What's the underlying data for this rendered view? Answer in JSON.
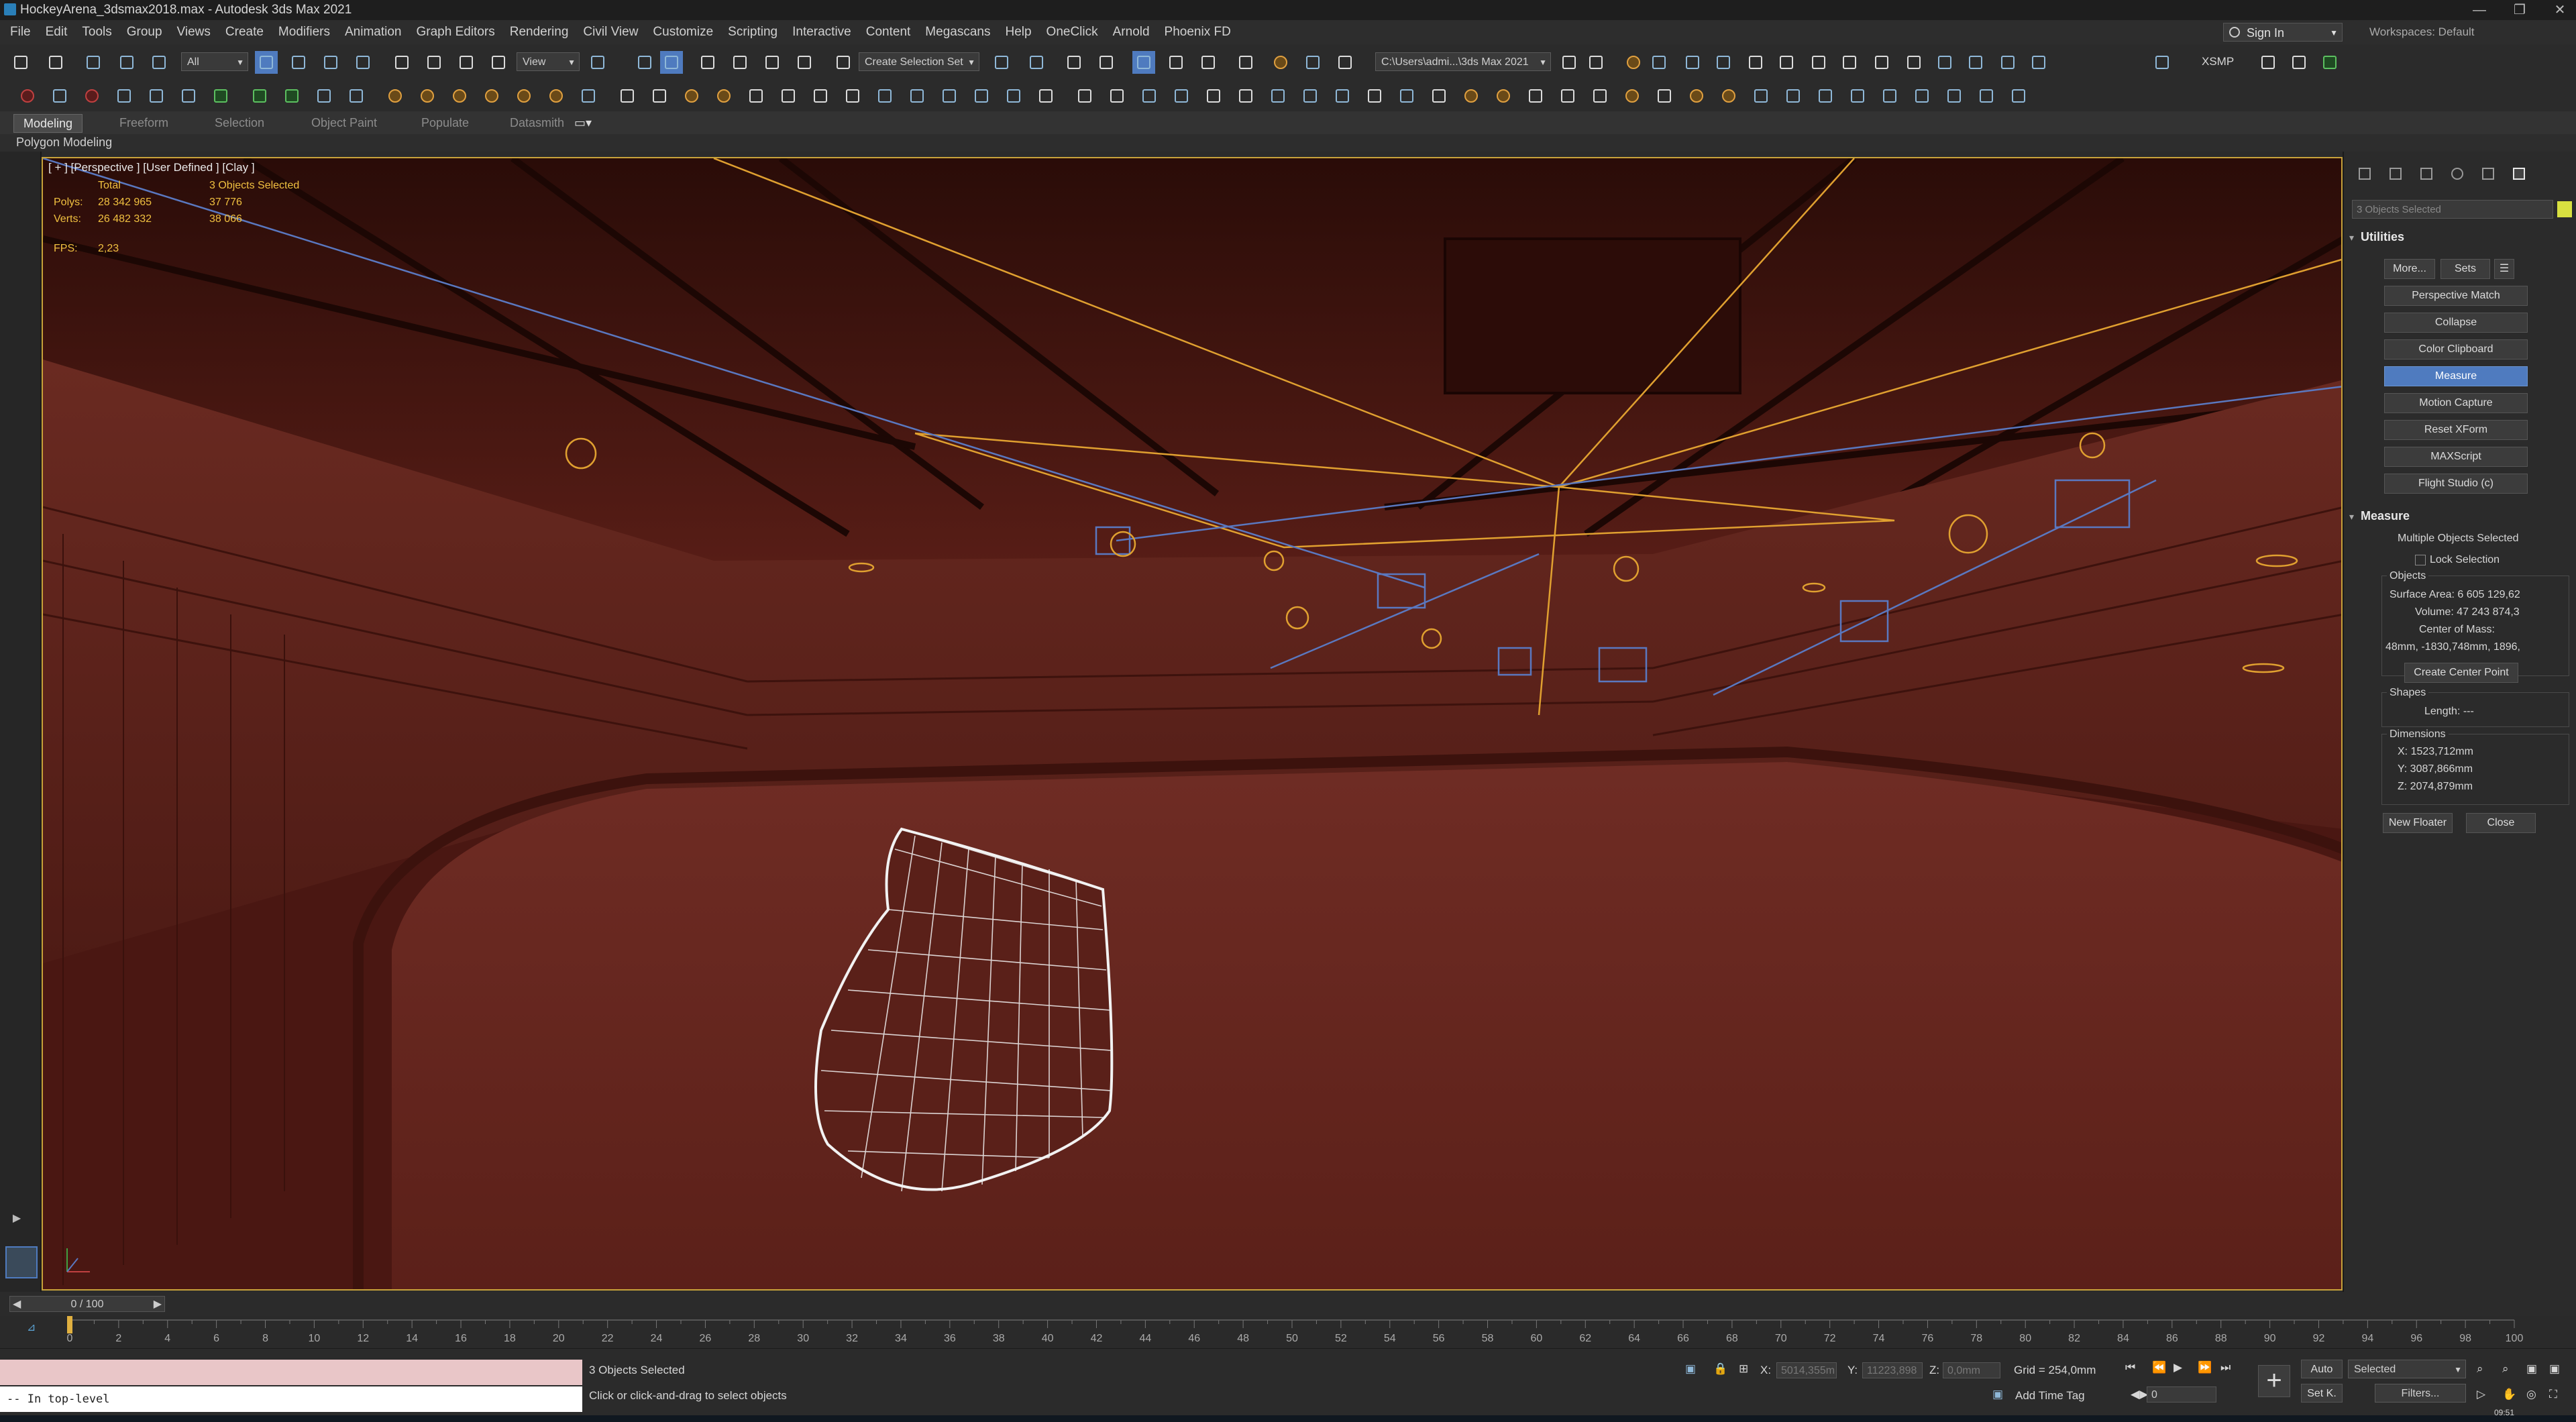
{
  "window": {
    "title": "HockeyArena_3dsmax2018.max - Autodesk 3ds Max 2021",
    "minimize": "—",
    "maximize": "❐",
    "close": "✕"
  },
  "menu": {
    "items": [
      "File",
      "Edit",
      "Tools",
      "Group",
      "Views",
      "Create",
      "Modifiers",
      "Animation",
      "Graph Editors",
      "Rendering",
      "Civil View",
      "Customize",
      "Scripting",
      "Interactive",
      "Content",
      "Megascans",
      "Help",
      "OneClick",
      "Arnold",
      "Phoenix FD"
    ],
    "sign_in": "Sign In",
    "workspaces": "Workspaces: Default"
  },
  "toolbar": {
    "filter": "All",
    "ref_coord": "View",
    "selection_set": "Create Selection Set",
    "project_path": "C:\\Users\\admi...\\3ds Max 2021",
    "xsmp": "XSMP"
  },
  "ribbon": {
    "tabs": [
      "Modeling",
      "Freeform",
      "Selection",
      "Object Paint",
      "Populate",
      "Datasmith"
    ],
    "active_tab": "Modeling",
    "subtitle": "Polygon Modeling"
  },
  "viewport": {
    "label": "[ + ] [Perspective ] [User Defined ] [Clay ]",
    "stats_header": [
      "",
      "Total",
      "3 Objects Selected"
    ],
    "stats_polys": [
      "Polys:",
      "28 342 965",
      "37 776"
    ],
    "stats_verts": [
      "Verts:",
      "26 482 332",
      "38 066"
    ],
    "fps_label": "FPS:",
    "fps_value": "2,23"
  },
  "command_panel": {
    "selection_name": "3 Objects Selected",
    "selection_color": "#d8e040",
    "utilities_title": "Utilities",
    "more": "More...",
    "sets": "Sets",
    "utilities": [
      "Perspective Match",
      "Collapse",
      "Color Clipboard",
      "Measure",
      "Motion Capture",
      "Reset XForm",
      "MAXScript",
      "Flight Studio (c)"
    ],
    "active_utility": "Measure",
    "measure_title": "Measure",
    "multiple": "Multiple Objects Selected",
    "lock_selection": "Lock Selection",
    "objects_label": "Objects",
    "surface_area": "Surface Area: 6 605 129,62",
    "volume": "Volume: 47 243 874,3",
    "center_of_mass": "Center of Mass:",
    "center_value": "48mm, -1830,748mm, 1896,",
    "create_center_point": "Create Center Point",
    "shapes_label": "Shapes",
    "length": "Length: ---",
    "dimensions_label": "Dimensions",
    "dim_x": "X:  1523,712mm",
    "dim_y": "Y:  3087,866mm",
    "dim_z": "Z:  2074,879mm",
    "new_floater": "New Floater",
    "close": "Close"
  },
  "timeline": {
    "slider": "0 / 100",
    "ticks": [
      "0",
      "2",
      "4",
      "6",
      "8",
      "10",
      "12",
      "14",
      "16",
      "18",
      "20",
      "22",
      "24",
      "26",
      "28",
      "30",
      "32",
      "34",
      "36",
      "38",
      "40",
      "42",
      "44",
      "46",
      "48",
      "50",
      "52",
      "54",
      "56",
      "58",
      "60",
      "62",
      "64",
      "66",
      "68",
      "70",
      "72",
      "74",
      "76",
      "78",
      "80",
      "82",
      "84",
      "86",
      "88",
      "90",
      "92",
      "94",
      "96",
      "98",
      "100"
    ],
    "current_frame": 0,
    "total_frames": 100
  },
  "status": {
    "maxscript_output": "-- In top-level",
    "selected": "3 Objects Selected",
    "prompt": "Click or click-and-drag to select objects",
    "x_label": "X:",
    "x_value": "5014,355m",
    "y_label": "Y:",
    "y_value": "11223,898",
    "z_label": "Z:",
    "z_value": "0,0mm",
    "grid": "Grid = 254,0mm",
    "add_time_tag": "Add Time Tag",
    "auto": "Auto",
    "set_key": "Set K.",
    "key_filter": "Selected",
    "filters": "Filters...",
    "frame_field": "0",
    "clock": "09:51"
  }
}
